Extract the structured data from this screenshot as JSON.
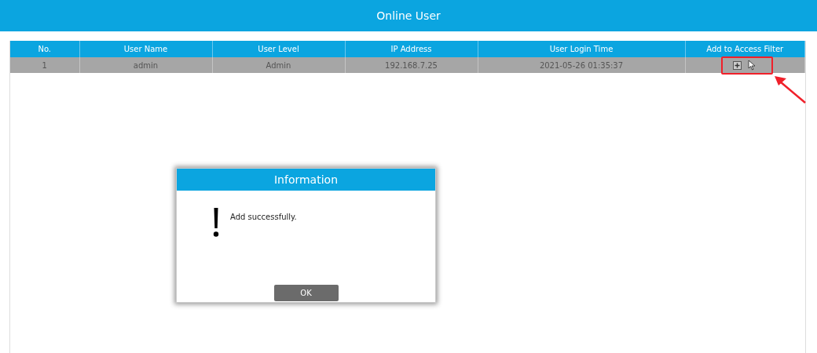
{
  "header": {
    "title": "Online User"
  },
  "table": {
    "columns": [
      "No.",
      "User Name",
      "User Level",
      "IP Address",
      "User Login Time",
      "Add to Access Filter"
    ],
    "rows": [
      {
        "cells": [
          "1",
          "admin",
          "Admin",
          "192.168.7.25",
          "2021-05-26 01:35:37"
        ],
        "selected": true
      }
    ]
  },
  "dialog": {
    "title": "Information",
    "message": "Add successfully.",
    "button": "OK"
  }
}
